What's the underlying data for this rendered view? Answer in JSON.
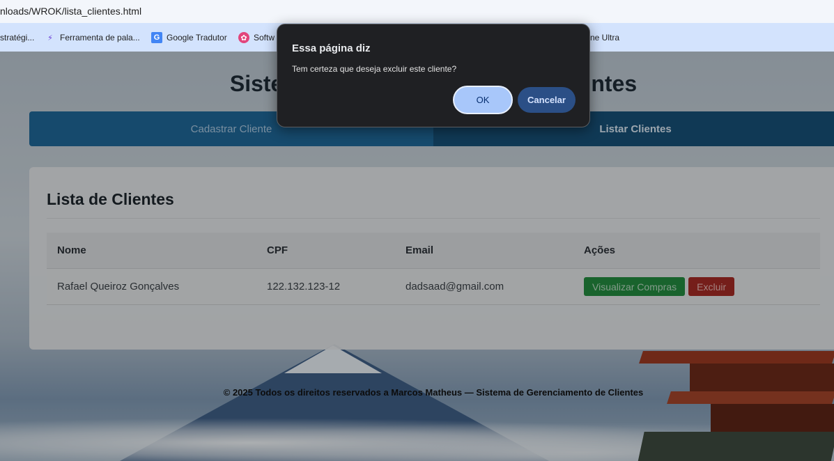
{
  "browser": {
    "url": "nloads/WROK/lista_clientes.html",
    "bookmarks": [
      {
        "label": "stratégi...",
        "icon": "bookmark-icon"
      },
      {
        "label": "Ferramenta de pala...",
        "icon": "tool-icon"
      },
      {
        "label": "Google Tradutor",
        "icon": "google-translate-icon"
      },
      {
        "label": "Softw",
        "icon": "software-icon"
      },
      {
        "label": "ne Ultra",
        "icon": "none"
      }
    ]
  },
  "page": {
    "title_left": "Siste",
    "title_right": "ntes",
    "tabs": [
      {
        "label": "Cadastrar Cliente",
        "active": false
      },
      {
        "label": "Listar Clientes",
        "active": true
      }
    ],
    "list_title": "Lista de Clientes",
    "table": {
      "headers": [
        "Nome",
        "CPF",
        "Email",
        "Ações"
      ],
      "rows": [
        {
          "nome": "Rafael Queiroz Gonçalves",
          "cpf": "122.132.123-12",
          "email": "dadsaad@gmail.com",
          "view_label": "Visualizar Compras",
          "delete_label": "Excluir"
        }
      ]
    },
    "footer": "© 2025 Todos os direitos reservados a Marcos Matheus — Sistema de Gerenciamento de Clientes"
  },
  "dialog": {
    "title": "Essa página diz",
    "message": "Tem certeza que deseja excluir este cliente?",
    "ok_label": "OK",
    "cancel_label": "Cancelar"
  },
  "colors": {
    "accent": "#a8c7fa",
    "tab_blue": "#1f6797",
    "green": "#23893f",
    "red": "#a32a24"
  }
}
